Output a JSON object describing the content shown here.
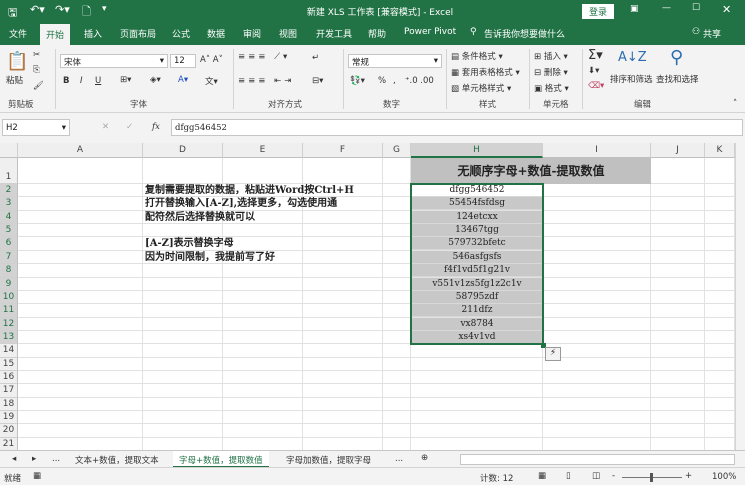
{
  "title_bar": {
    "title": "新建 XLS 工作表 [兼容模式] - Excel",
    "login": "登录",
    "icons": [
      "save-icon",
      "undo-icon",
      "redo-icon",
      "preview-icon",
      "customize-icon",
      "ribbon-display-icon",
      "minimize-icon",
      "maximize-icon",
      "close-icon"
    ]
  },
  "tabs": [
    "文件",
    "开始",
    "插入",
    "页面布局",
    "公式",
    "数据",
    "审阅",
    "视图",
    "开发工具",
    "帮助",
    "Power Pivot"
  ],
  "active_tab": "开始",
  "tell_me": "告诉我你想要做什么",
  "share": "共享",
  "ribbon": {
    "clipboard": {
      "paste": "粘贴",
      "label": "剪贴板"
    },
    "font": {
      "name": "宋体",
      "size": "12",
      "bold": "B",
      "italic": "I",
      "underline": "U",
      "label": "字体"
    },
    "alignment": {
      "label": "对齐方式"
    },
    "number": {
      "format": "常规",
      "percent": "%",
      "comma": ",",
      "label": "数字"
    },
    "styles": {
      "conditional": "条件格式",
      "table": "套用表格格式",
      "cell": "单元格样式",
      "label": "样式"
    },
    "cells": {
      "insert": "插入",
      "delete": "删除",
      "format": "格式",
      "label": "单元格"
    },
    "editing": {
      "sort": "排序和筛选",
      "find": "查找和选择",
      "label": "编辑"
    }
  },
  "formula_bar": {
    "name_box": "H2",
    "fx": "fx",
    "value": "dfgg546452"
  },
  "columns": [
    "A",
    "D",
    "E",
    "F",
    "G",
    "H",
    "I",
    "J",
    "K"
  ],
  "rows": [
    "1",
    "2",
    "3",
    "4",
    "5",
    "6",
    "7",
    "8",
    "9",
    "10",
    "11",
    "12",
    "13",
    "14",
    "15",
    "16",
    "17",
    "18",
    "19",
    "20",
    "21"
  ],
  "header_title": "无顺序字母+数值-提取数值",
  "data_values": [
    "dfgg546452",
    "55454fsfdsg",
    "124etcxx",
    "13467tgg",
    "579732bfetc",
    "546asfgsfs",
    "f4f1vd5f1g21v",
    "v551v1zs5fg1z2c1v",
    "58795zdf",
    "211dfz",
    "vx8784",
    "xs4v1vd"
  ],
  "notes": [
    "复制需要提取的数据，粘贴进Word按Ctrl+H",
    "打开替换输入[A-Z],选择更多，勾选使用通",
    "配符然后选择替换就可以",
    "",
    "[A-Z]表示替换字母",
    "因为时间限制，我提前写了好"
  ],
  "sheet_tabs": [
    "文本+数值，提取文本",
    "字母+数值，提取数值",
    "字母加数值，提取字母"
  ],
  "active_sheet": "字母+数值，提取数值",
  "sheet_nav": "...",
  "status": {
    "ready": "就绪",
    "count": "计数: 12",
    "zoom": "100%"
  },
  "colors": {
    "accent": "#217346",
    "data_fill": "#c8c8c8"
  }
}
